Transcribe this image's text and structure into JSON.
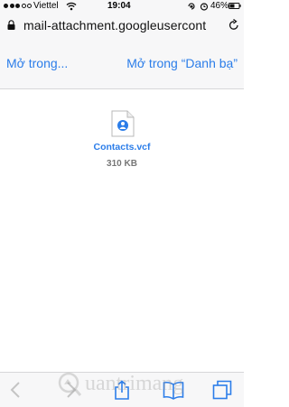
{
  "status_bar": {
    "carrier": "Viettel",
    "time": "19:04",
    "battery_percent": "46%",
    "icons": [
      "signal-dots",
      "wifi-icon",
      "rotation-lock-icon",
      "alarm-icon",
      "battery-icon"
    ]
  },
  "address_bar": {
    "url": "mail-attachment.googleusercont",
    "icons": [
      "padlock-icon",
      "reload-icon"
    ]
  },
  "actions": {
    "open_in_label": "Mở trong...",
    "open_in_contacts_label": "Mở trong “Danh bạ”"
  },
  "attachment": {
    "filename": "Contacts.vcf",
    "size": "310 KB",
    "icon": "contact-file-icon"
  },
  "toolbar": {
    "icons": [
      "back-icon",
      "forward-icon",
      "share-icon",
      "bookmarks-icon",
      "tabs-icon"
    ]
  },
  "watermark": {
    "text": "uantrimang"
  },
  "colors": {
    "accent": "#2b7de9",
    "chrome_bg": "#f7f7f8",
    "separator": "#d7d7d9",
    "muted_text": "#777777"
  }
}
